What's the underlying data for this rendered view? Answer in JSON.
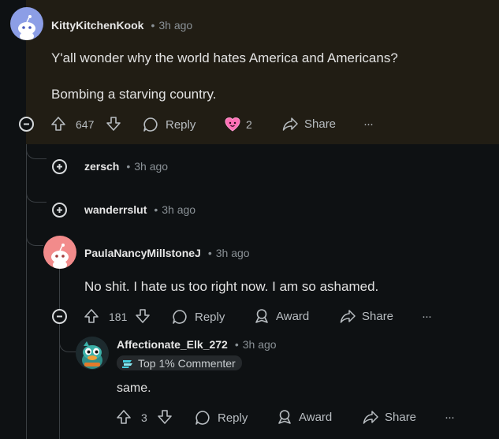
{
  "comment1": {
    "username": "KittyKitchenKook",
    "time": "3h ago",
    "body_line1": "Y'all wonder why the world hates America and Americans?",
    "body_line2": "Bombing a starving country.",
    "votes": "647",
    "reply_label": "Reply",
    "award_count": "2",
    "share_label": "Share",
    "more": "···"
  },
  "collapsed": [
    {
      "username": "zersch",
      "time": "3h ago"
    },
    {
      "username": "wanderrslut",
      "time": "3h ago"
    }
  ],
  "comment2": {
    "username": "PaulaNancyMillstoneJ",
    "time": "3h ago",
    "body": "No shit. I hate us too right now. I am so ashamed.",
    "votes": "181",
    "reply_label": "Reply",
    "award_label": "Award",
    "share_label": "Share",
    "more": "···"
  },
  "comment3": {
    "username": "Affectionate_Elk_272",
    "time": "3h ago",
    "badge": "Top 1% Commenter",
    "body": "same.",
    "votes": "3",
    "reply_label": "Reply",
    "award_label": "Award",
    "share_label": "Share",
    "more": "···"
  },
  "colors": {
    "background": "#0e1113",
    "highlight": "#211d14",
    "text": "#e6e6e6",
    "muted": "#8a9196",
    "thread_line": "#3a3f43",
    "avatar1": "#8c9ee6",
    "avatar2": "#f28b8b"
  },
  "icons": [
    "upvote-icon",
    "downvote-icon",
    "reply-bubble-icon",
    "award-heart-icon",
    "award-ribbon-icon",
    "share-arrow-icon",
    "more-icon",
    "expand-icon",
    "collapse-icon",
    "snoo-avatar-icon",
    "top-commenter-icon"
  ]
}
